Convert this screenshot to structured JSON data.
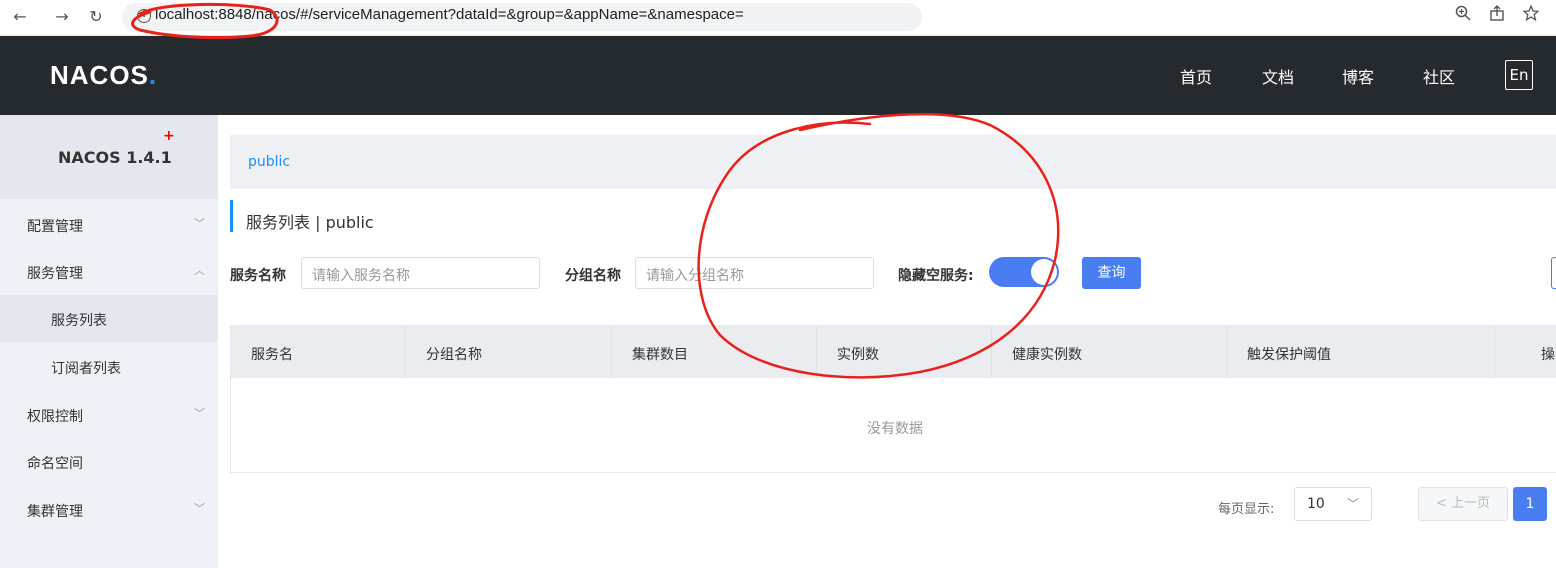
{
  "browser": {
    "url": "localhost:8848/nacos/#/serviceManagement?dataId=&group=&appName=&namespace=",
    "info_glyph": "i",
    "back": "←",
    "forward": "→",
    "reload": "↻"
  },
  "topnav": {
    "logo_text": "NACOS",
    "logo_dot": ".",
    "links": [
      "首页",
      "文档",
      "博客",
      "社区"
    ],
    "lang": "En"
  },
  "sidebar": {
    "version": "NACOS 1.4.1",
    "items": [
      {
        "label": "配置管理",
        "chevron": "﹀"
      },
      {
        "label": "服务管理",
        "chevron": "︿"
      },
      {
        "label": "服务列表"
      },
      {
        "label": "订阅者列表"
      },
      {
        "label": "权限控制",
        "chevron": "﹀"
      },
      {
        "label": "命名空间"
      },
      {
        "label": "集群管理",
        "chevron": "﹀"
      }
    ]
  },
  "main": {
    "namespace": "public",
    "title": "服务列表 | public",
    "filters": {
      "service_name_label": "服务名称",
      "service_name_placeholder": "请输入服务名称",
      "group_name_label": "分组名称",
      "group_name_placeholder": "请输入分组名称",
      "hide_empty_label": "隐藏空服务:",
      "hide_empty_on": true,
      "query_button": "查询"
    },
    "table": {
      "columns": [
        "服务名",
        "分组名称",
        "集群数目",
        "实例数",
        "健康实例数",
        "触发保护阈值",
        "操"
      ],
      "empty_text": "没有数据"
    },
    "pagination": {
      "per_page_label": "每页显示:",
      "per_page_value": "10",
      "prev_label": "< 上一页",
      "current_page": "1"
    }
  },
  "colors": {
    "primary": "#4a7cf2",
    "topnav_bg": "#252a2f",
    "sidebar_bg": "#eef1f5",
    "annotation": "#e8221b"
  }
}
